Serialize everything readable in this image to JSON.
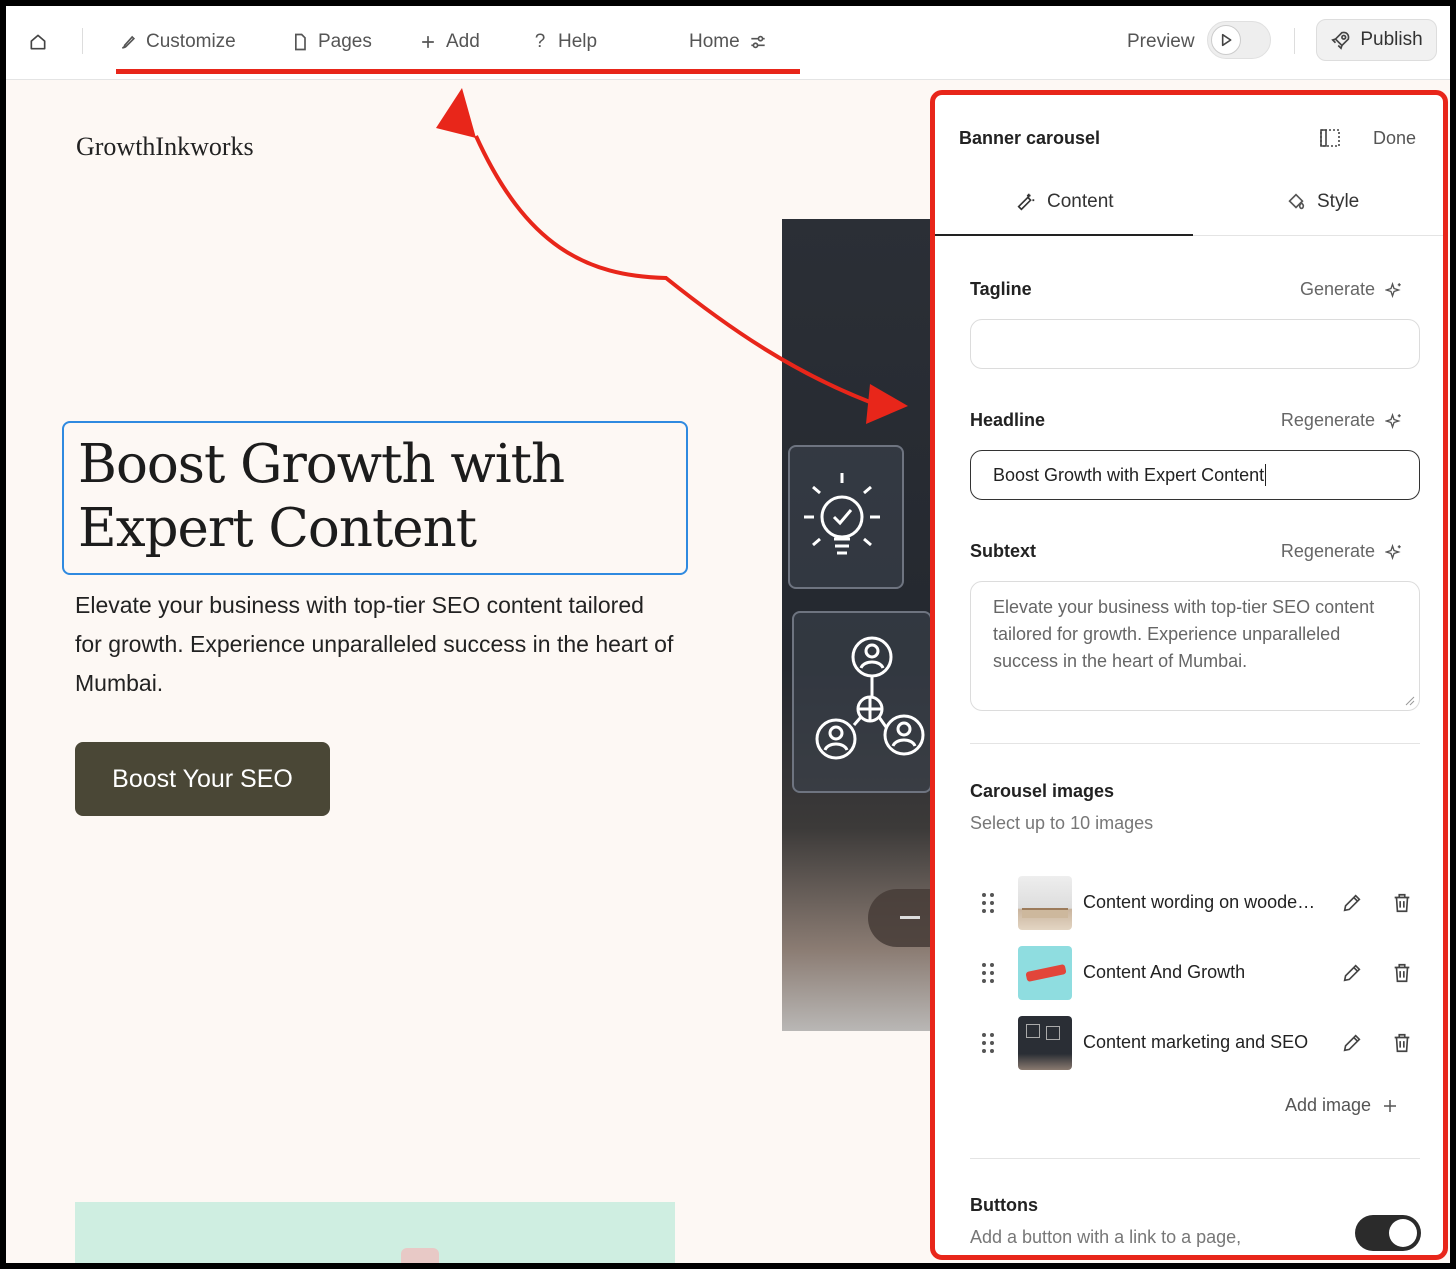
{
  "toolbar": {
    "customize": "Customize",
    "pages": "Pages",
    "add": "Add",
    "help": "Help",
    "page_select": "Home",
    "preview": "Preview",
    "publish": "Publish"
  },
  "site": {
    "logo": "GrowthInkworks",
    "headline": "Boost Growth with Expert Content",
    "subtext": "Elevate your business with top-tier SEO content tailored for growth. Experience unparalleled success in the heart of Mumbai.",
    "cta": "Boost Your SEO"
  },
  "panel": {
    "title": "Banner carousel",
    "done": "Done",
    "tabs": [
      {
        "label": "Content",
        "active": true
      },
      {
        "label": "Style",
        "active": false
      }
    ],
    "tagline": {
      "label": "Tagline",
      "action": "Generate",
      "value": ""
    },
    "headline": {
      "label": "Headline",
      "action": "Regenerate",
      "value": "Boost Growth with Expert Content"
    },
    "subtext": {
      "label": "Subtext",
      "action": "Regenerate",
      "value": "Elevate your business with top-tier SEO content tailored for growth. Experience unparalleled success in the heart of Mumbai."
    },
    "carousel": {
      "title": "Carousel images",
      "subtitle": "Select up to 10 images",
      "images": [
        {
          "name": "Content wording on wooden blocks"
        },
        {
          "name": "Content And Growth"
        },
        {
          "name": "Content marketing and SEO"
        }
      ],
      "add_label": "Add image"
    },
    "buttons": {
      "title": "Buttons",
      "subtitle": "Add a button with a link to a page,",
      "enabled": true
    }
  },
  "colors": {
    "accent_red": "#e8261a",
    "focus_blue": "#2f8ae0",
    "cta_bg": "#4a4736",
    "canvas_bg": "#fdf8f4"
  }
}
